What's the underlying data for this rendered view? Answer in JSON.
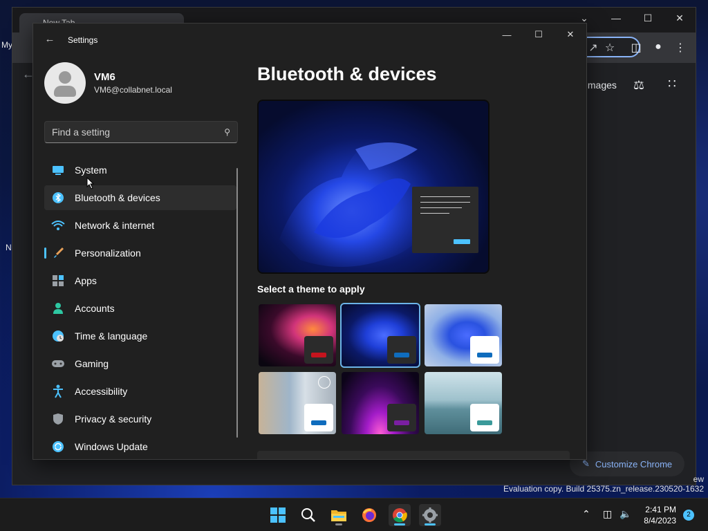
{
  "chrome": {
    "tab_title": "New Tab",
    "images_link": "Images",
    "customize_button": "Customize Chrome",
    "side_labels": [
      "My",
      "N"
    ]
  },
  "watermark": {
    "text": "Evaluation copy. Build 25375.zn_release.230520-1632",
    "partial": "ew"
  },
  "settings": {
    "app_title": "Settings",
    "user": {
      "name": "VM6",
      "email": "VM6@collabnet.local"
    },
    "search": {
      "placeholder": "Find a setting"
    },
    "nav": [
      {
        "label": "System",
        "icon": "system-icon",
        "color": "#4cc2ff"
      },
      {
        "label": "Bluetooth & devices",
        "icon": "bluetooth-icon",
        "color": "#4cc2ff",
        "selected": true
      },
      {
        "label": "Network & internet",
        "icon": "wifi-icon",
        "color": "#4cc2ff"
      },
      {
        "label": "Personalization",
        "icon": "brush-icon",
        "color": "#e8a15a"
      },
      {
        "label": "Apps",
        "icon": "apps-icon",
        "color": "#b0b0b0"
      },
      {
        "label": "Accounts",
        "icon": "person-icon",
        "color": "#2ec7a2"
      },
      {
        "label": "Time & language",
        "icon": "globe-clock-icon",
        "color": "#4cc2ff"
      },
      {
        "label": "Gaming",
        "icon": "gamepad-icon",
        "color": "#b0b0b0"
      },
      {
        "label": "Accessibility",
        "icon": "accessibility-icon",
        "color": "#4cc2ff"
      },
      {
        "label": "Privacy & security",
        "icon": "shield-icon",
        "color": "#b0b0b0"
      },
      {
        "label": "Windows Update",
        "icon": "update-icon",
        "color": "#4cc2ff"
      }
    ],
    "page_title": "Bluetooth & devices",
    "theme_section_label": "Select a theme to apply",
    "themes": [
      {
        "name": "glow",
        "accent": "#c4141e",
        "swatch_bg": "#2b2b2b"
      },
      {
        "name": "windows-dark",
        "accent": "#0f6cbd",
        "swatch_bg": "#2b2b2b",
        "selected": true
      },
      {
        "name": "windows-light",
        "accent": "#0f6cbd",
        "swatch_bg": "#ffffff"
      },
      {
        "name": "captured-motion",
        "accent": "#0f6cbd",
        "swatch_bg": "#ffffff"
      },
      {
        "name": "sunrise",
        "accent": "#7a1fa2",
        "swatch_bg": "#2b2b2b"
      },
      {
        "name": "flow",
        "accent": "#3a9a9a",
        "swatch_bg": "#ffffff"
      }
    ]
  },
  "taskbar": {
    "apps": [
      "start-icon",
      "search-icon",
      "file-explorer-icon",
      "firefox-icon",
      "chrome-icon",
      "settings-icon"
    ],
    "time": "2:41 PM",
    "date": "8/4/2023",
    "notifications": "2"
  }
}
